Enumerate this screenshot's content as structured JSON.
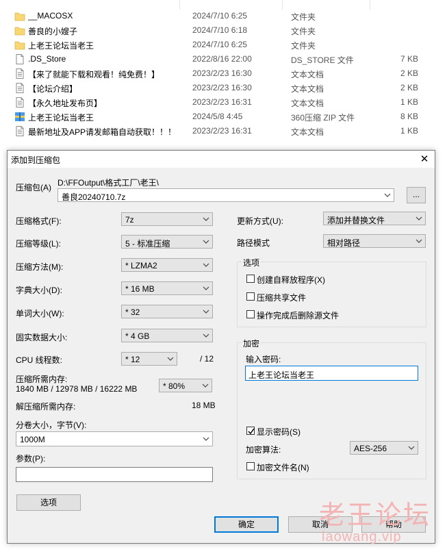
{
  "files": [
    {
      "name": "__MACOSX",
      "date": "2024/7/10 6:25",
      "type": "文件夹",
      "size": "",
      "icon": "folder-icon"
    },
    {
      "name": "善良的小嫂子",
      "date": "2024/7/10 6:18",
      "type": "文件夹",
      "size": "",
      "icon": "folder-icon"
    },
    {
      "name": "上老王论坛当老王",
      "date": "2024/7/10 6:25",
      "type": "文件夹",
      "size": "",
      "icon": "folder-icon"
    },
    {
      "name": ".DS_Store",
      "date": "2022/8/16 22:00",
      "type": "DS_STORE 文件",
      "size": "7 KB",
      "icon": "file-icon"
    },
    {
      "name": "【来了就能下载和观看！纯免费！】",
      "date": "2023/2/23 16:30",
      "type": "文本文档",
      "size": "2 KB",
      "icon": "text-file-icon"
    },
    {
      "name": "【论坛介绍】",
      "date": "2023/2/23 16:30",
      "type": "文本文档",
      "size": "2 KB",
      "icon": "text-file-icon"
    },
    {
      "name": "【永久地址发布页】",
      "date": "2023/2/23 16:31",
      "type": "文本文档",
      "size": "1 KB",
      "icon": "text-file-icon"
    },
    {
      "name": "上老王论坛当老王",
      "date": "2024/5/8 4:45",
      "type": "360压缩 ZIP 文件",
      "size": "8 KB",
      "icon": "zip-file-icon"
    },
    {
      "name": "最新地址及APP请发邮箱自动获取！！！",
      "date": "2023/2/23 16:31",
      "type": "文本文档",
      "size": "1 KB",
      "icon": "text-file-icon"
    }
  ],
  "dialog": {
    "title": "添加到压缩包",
    "close": "✕",
    "archive_label": "压缩包(A)",
    "archive_path": "D:\\FFOutput\\格式工厂\\老王\\",
    "archive_name": "善良20240710.7z",
    "browse_label": "...",
    "left_fields": [
      {
        "label": "压缩格式(F):",
        "value": "7z"
      },
      {
        "label": "压缩等级(L):",
        "value": "5 - 标准压缩"
      },
      {
        "label": "压缩方法(M):",
        "value": "* LZMA2"
      },
      {
        "label": "字典大小(D):",
        "value": "* 16 MB"
      },
      {
        "label": "单词大小(W):",
        "value": "* 32"
      },
      {
        "label": "固实数据大小:",
        "value": "* 4 GB"
      }
    ],
    "cpu_label": "CPU 线程数:",
    "cpu_value": "* 12",
    "cpu_max": "/ 12",
    "mem_label": "压缩所需内存:",
    "mem_values": "1840 MB / 12978 MB / 16222 MB",
    "mem_percent": "* 80%",
    "decomp_label": "解压缩所需内存:",
    "decomp_value": "18 MB",
    "split_label": "分卷大小，字节(V):",
    "split_value": "1000M",
    "params_label": "参数(P):",
    "params_value": "",
    "options_button": "选项",
    "update_label": "更新方式(U):",
    "update_value": "添加并替换文件",
    "pathmode_label": "路径模式",
    "pathmode_value": "相对路径",
    "options_group": "选项",
    "opt_sfx": "创建自释放程序(X)",
    "opt_shared": "压缩共享文件",
    "opt_delete": "操作完成后删除源文件",
    "encrypt_group": "加密",
    "password_label": "输入密码:",
    "password_value": "上老王论坛当老王",
    "show_password": "显示密码(S)",
    "show_password_checked": true,
    "enc_method_label": "加密算法:",
    "enc_method_value": "AES-256",
    "encrypt_names": "加密文件名(N)",
    "ok": "确定",
    "cancel": "取消",
    "help": "帮助"
  },
  "watermark": {
    "text": "老王论坛",
    "url": "laowang.vip"
  },
  "colors": {
    "accent": "#0078d7",
    "folder": "#f8d775",
    "watermark": "#f3b3b3"
  }
}
